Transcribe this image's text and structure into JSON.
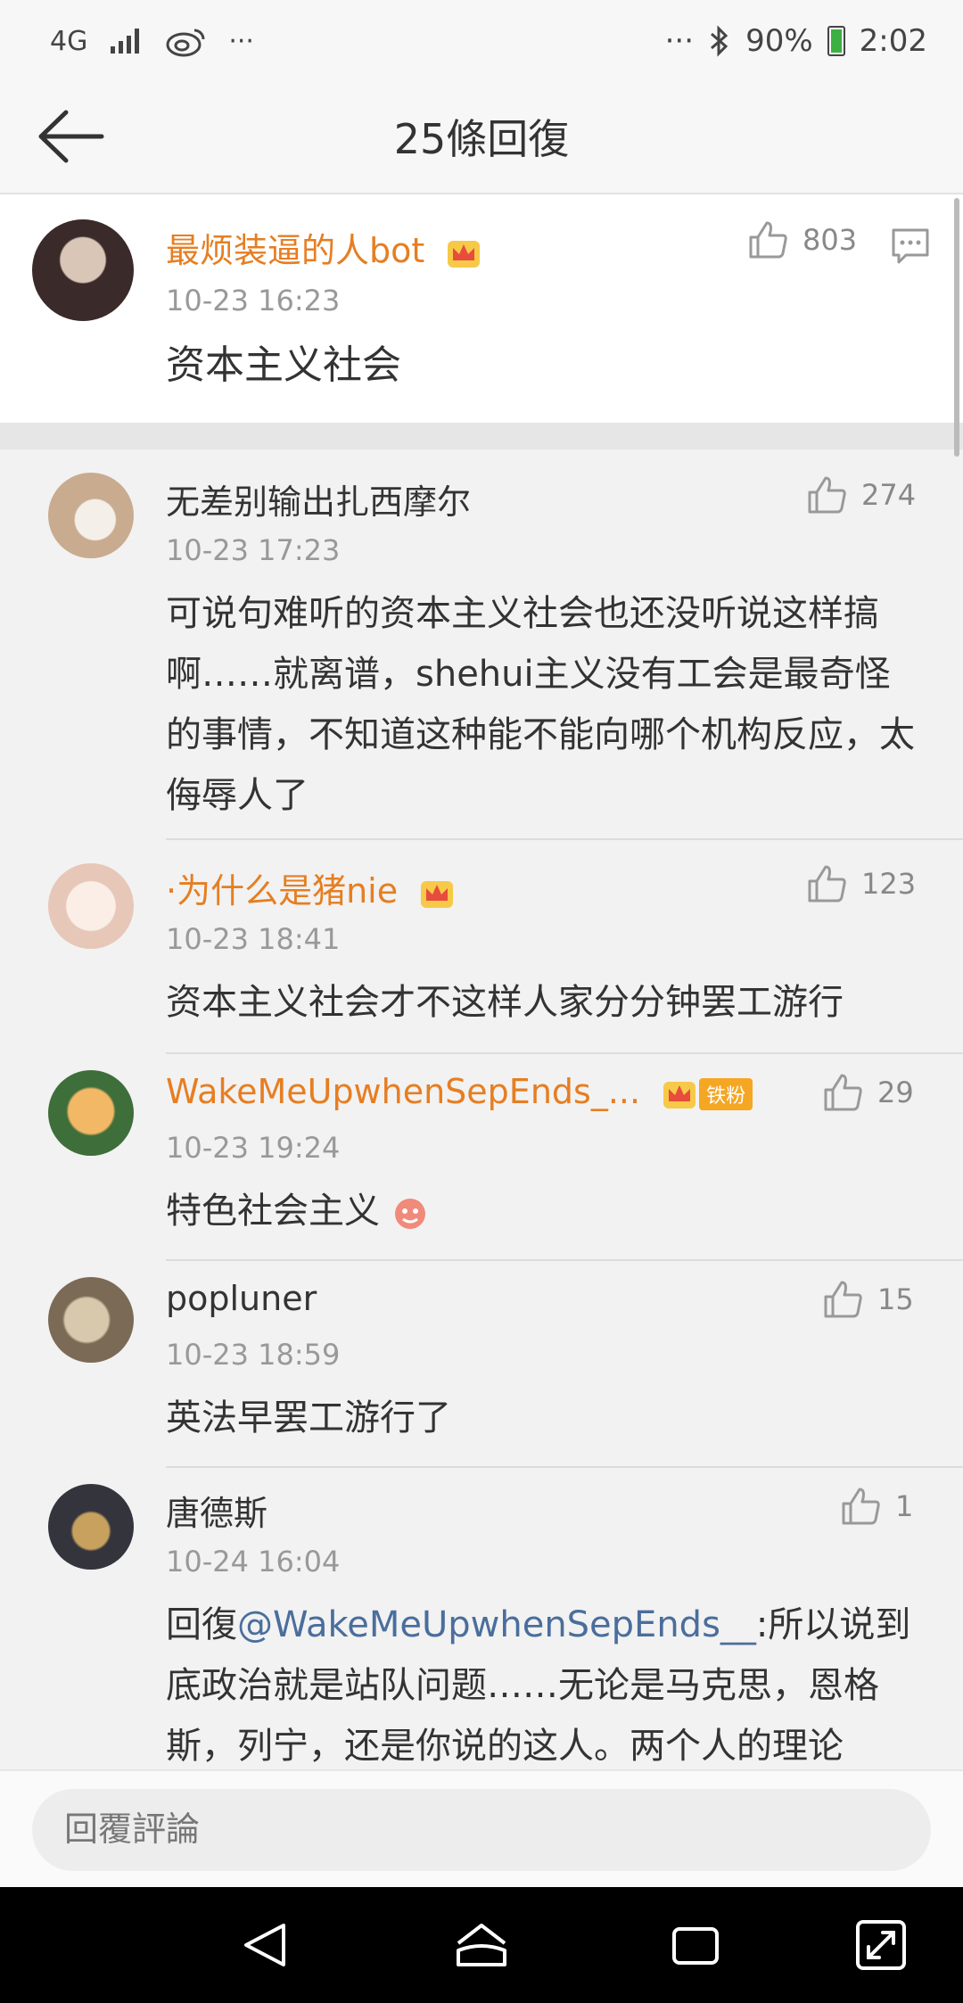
{
  "status_bar": {
    "network": "4G",
    "dots_left": "···",
    "dots_right": "···",
    "battery": "90%",
    "time": "2:02"
  },
  "header": {
    "title": "25條回復"
  },
  "comments": [
    {
      "name": "最烦装逼的人bot",
      "time": "10-23 16:23",
      "likes": "803",
      "text": "资本主义社会",
      "name_color": "#e67e22"
    },
    {
      "name": "无差别输出扎西摩尔",
      "time": "10-23 17:23",
      "likes": "274",
      "text": "可说句难听的资本主义社会也还没听说这样搞啊……就离谱，shehui主义没有工会是最奇怪的事情，不知道这种能不能向哪个机构反应，太侮辱人了"
    },
    {
      "name": "·为什么是猪nie",
      "time": "10-23 18:41",
      "likes": "123",
      "text": "资本主义社会才不这样人家分分钟罢工游行",
      "name_color": "#e67e22"
    },
    {
      "name": "WakeMeUpwhenSepEnds_...",
      "badge": "铁粉",
      "time": "10-23 19:24",
      "likes": "29",
      "text": "特色社会主义",
      "name_color": "#e67e22"
    },
    {
      "name": "popluner",
      "time": "10-23 18:59",
      "likes": "15",
      "text": "英法早罢工游行了"
    },
    {
      "name": "唐德斯",
      "time": "10-24 16:04",
      "likes": "1",
      "reply_prefix": "回復",
      "mention": "@WakeMeUpwhenSepEnds__",
      "text": ":所以说到底政治就是站队问题……无论是马克思，恩格斯，列宁，还是你说的这人。两个人的理论"
    }
  ],
  "input": {
    "placeholder": "回覆評論"
  },
  "colors": {
    "accent_orange": "#e67e22",
    "mention_blue": "#4a6e9c"
  }
}
